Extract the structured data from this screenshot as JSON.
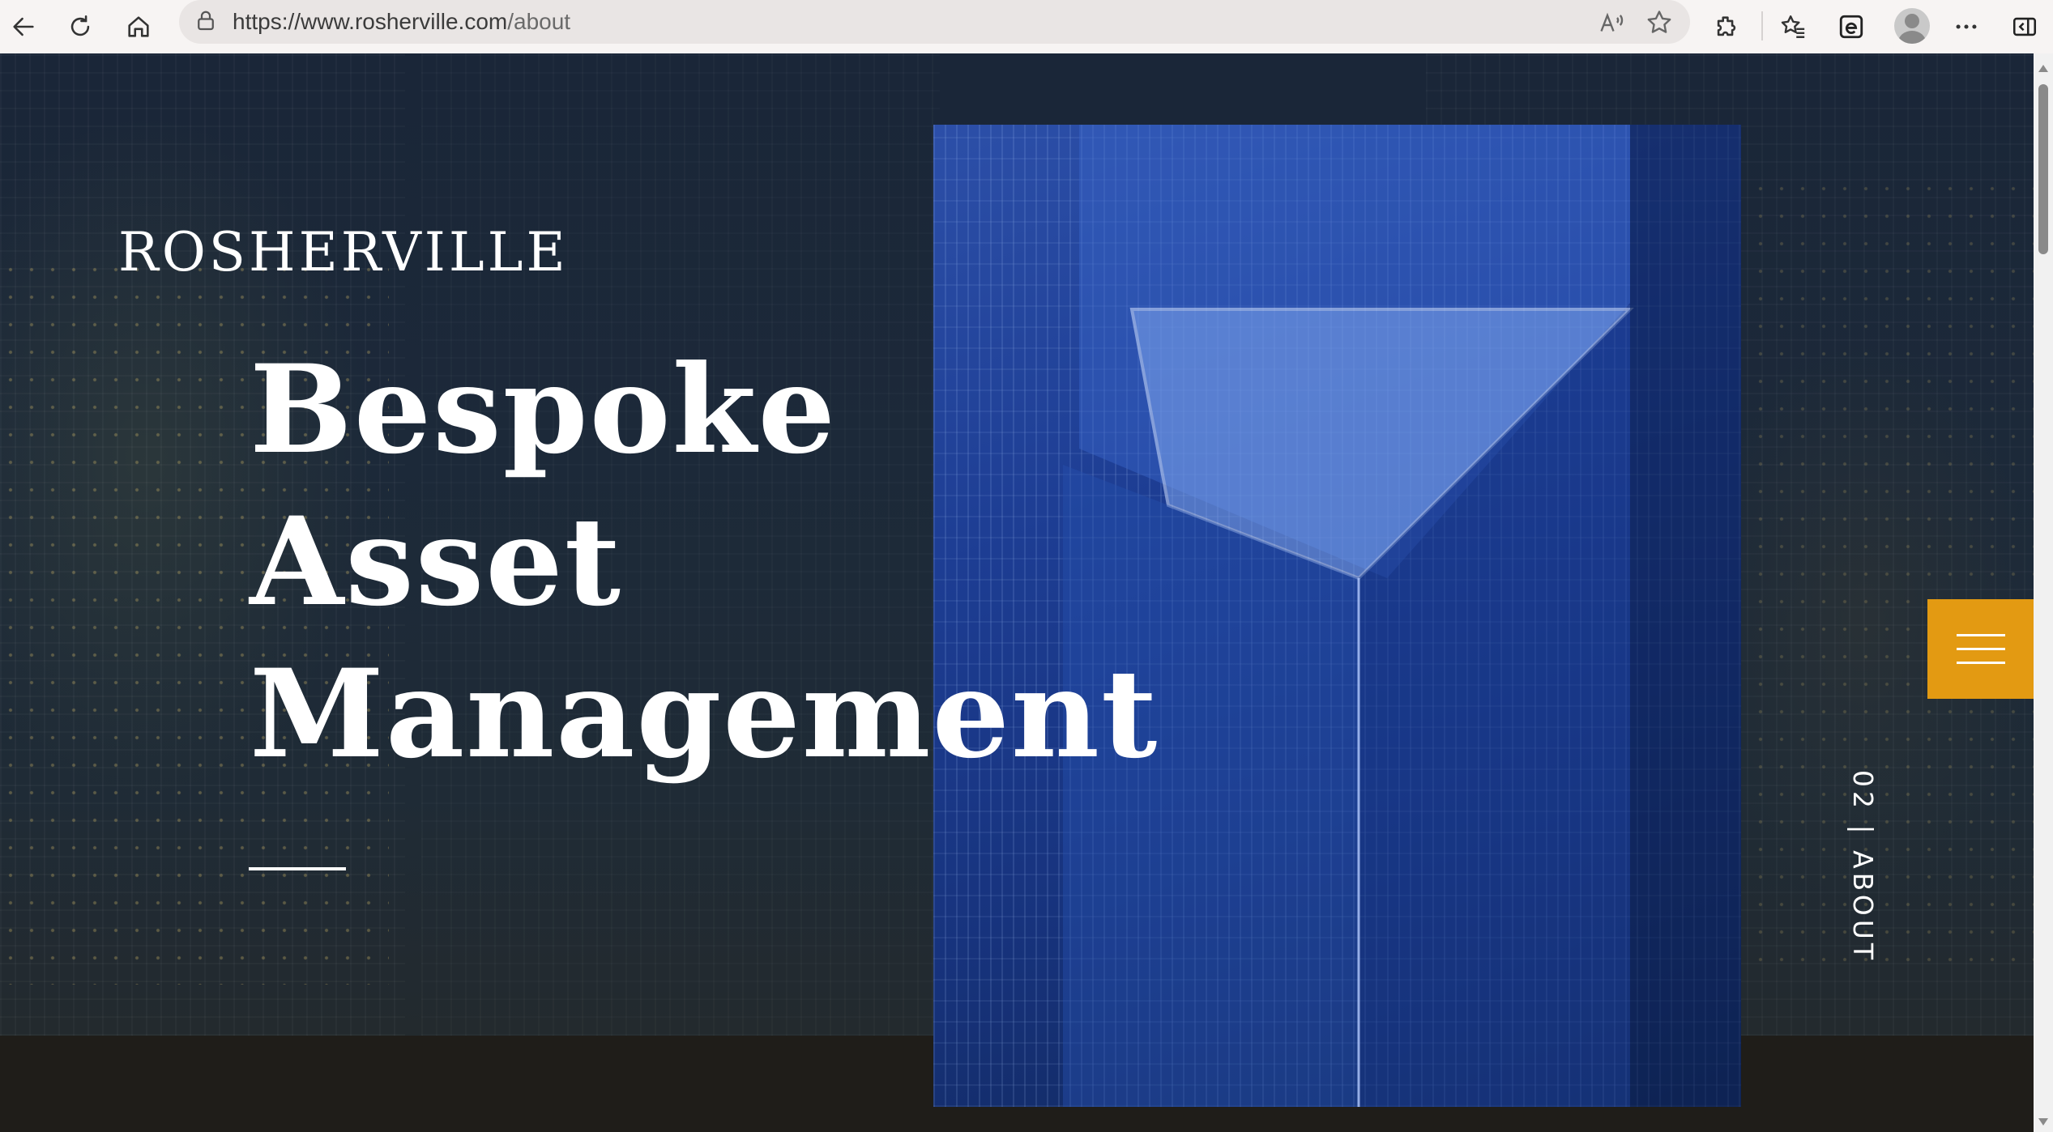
{
  "browser": {
    "url_host": "https://www.rosherville.com",
    "url_path": "/about"
  },
  "site": {
    "brand": "ROSHERVILLE",
    "headline": [
      "Bespoke",
      "Asset",
      "Management"
    ],
    "section_label": "02 | ABOUT"
  },
  "colors": {
    "accent": "#e39a12",
    "hero_overlay": "#1c2939",
    "footer_band": "#1f1d19",
    "photo_blue": "#1d3d93"
  },
  "icons": [
    "back-icon",
    "refresh-icon",
    "home-icon",
    "lock-icon",
    "read-aloud-icon",
    "favorite-star-icon",
    "extensions-icon",
    "favorites-icon",
    "ie-mode-icon",
    "profile-icon",
    "more-icon",
    "sidebar-icon",
    "hamburger-menu-icon"
  ]
}
